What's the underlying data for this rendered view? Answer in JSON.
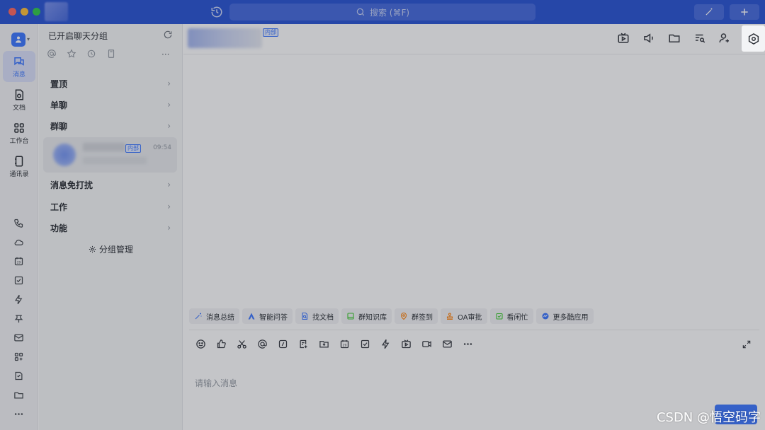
{
  "titlebar": {
    "search_placeholder": "搜索 (⌘F)"
  },
  "leftnav": {
    "items": [
      {
        "label": "消息",
        "icon": "chat-icon",
        "active": true
      },
      {
        "label": "文档",
        "icon": "doc-icon"
      },
      {
        "label": "工作台",
        "icon": "workspace-icon"
      },
      {
        "label": "通讯录",
        "icon": "contacts-icon"
      }
    ],
    "small_icons": [
      "phone-icon",
      "cloud-icon",
      "calendar-icon",
      "task-icon",
      "lightning-icon",
      "pin-icon",
      "mail-icon",
      "apps-icon",
      "minutes-icon",
      "folder-icon",
      "more-icon"
    ],
    "calendar_date": "29"
  },
  "chatlist": {
    "header": "已开启聊天分组",
    "groups_top": [
      {
        "label": "置顶"
      },
      {
        "label": "单聊"
      },
      {
        "label": "群聊"
      }
    ],
    "chat": {
      "badge": "内部",
      "time": "09:54"
    },
    "groups_bottom": [
      {
        "label": "消息免打扰"
      },
      {
        "label": "工作"
      },
      {
        "label": "功能"
      }
    ],
    "manage_label": "分组管理",
    "chevron": "›"
  },
  "main": {
    "title_badge": "内部",
    "header_icons": [
      "live-icon",
      "announce-icon",
      "folder-icon",
      "search-history-icon",
      "add-member-icon",
      "settings-icon"
    ],
    "apps": [
      {
        "label": "消息总结",
        "icon": "sparkle-icon",
        "color": "#3370ff"
      },
      {
        "label": "智能问答",
        "icon": "ai-answer-icon",
        "color": "#3370ff"
      },
      {
        "label": "找文档",
        "icon": "find-doc-icon",
        "color": "#3370ff"
      },
      {
        "label": "群知识库",
        "icon": "wiki-icon",
        "color": "#34c724"
      },
      {
        "label": "群签到",
        "icon": "checkin-icon",
        "color": "#ff7d00"
      },
      {
        "label": "OA审批",
        "icon": "approval-icon",
        "color": "#ff7d00"
      },
      {
        "label": "看闲忙",
        "icon": "free-busy-icon",
        "color": "#34c724"
      },
      {
        "label": "更多酷应用",
        "icon": "more-apps-icon",
        "color": "#3370ff"
      }
    ],
    "input_placeholder": "请输入消息",
    "toolbar_date": "29",
    "more_label": "···"
  },
  "watermark": "CSDN @悟空码字"
}
